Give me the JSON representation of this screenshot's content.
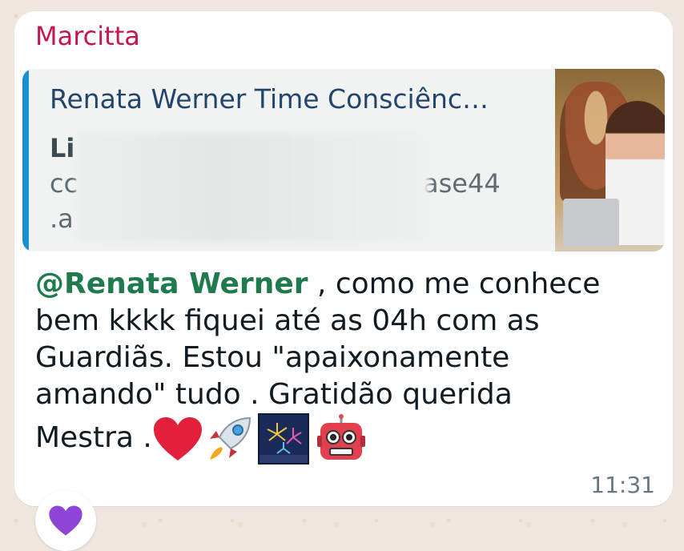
{
  "message": {
    "sender": "Marcitta",
    "quoted": {
      "title": "Renata Werner Time Consciênc…",
      "line1": "Li",
      "line2_start": "cc",
      "line2_end": "ase44",
      "line3": ".a"
    },
    "mention": "@Renata Werner",
    "text_line1": " , como me conhece",
    "text_line2": "bem kkkk fiquei até as 04h com as",
    "text_line3": "Guardiãs. Estou \"apaixonamente",
    "text_line4": "amando\"  tudo . Gratidão querida",
    "text_line5": "Mestra .",
    "emojis": [
      "heart-emoji",
      "rocket-emoji",
      "fireworks-emoji",
      "robot-emoji"
    ],
    "time": "11:31"
  },
  "reaction": {
    "icon": "purple-heart-emoji"
  },
  "colors": {
    "sender": "#c3174b",
    "mention": "#1f7a4e",
    "quote_bar": "#1b8fc9",
    "quote_title": "#22466b",
    "time": "#667781"
  }
}
